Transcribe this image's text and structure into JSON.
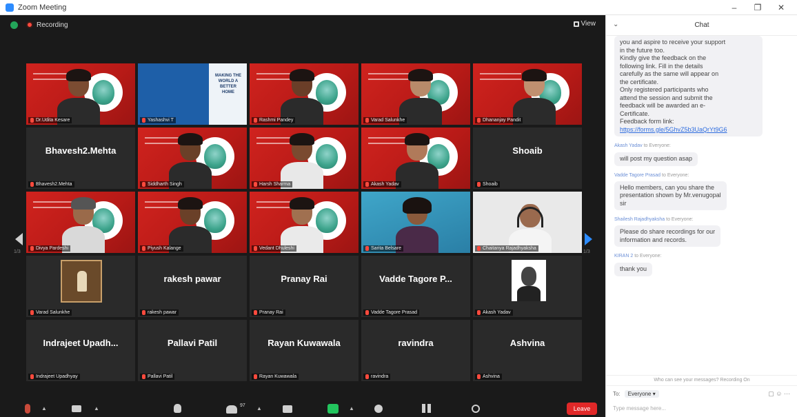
{
  "window": {
    "title": "Zoom Meeting",
    "controls": [
      "–",
      "❐",
      "✕"
    ]
  },
  "topbar": {
    "recording_label": "Recording",
    "view_label": "View"
  },
  "colors": {
    "accent": "#2D8CFF",
    "recording": "#ff4a3d",
    "leave": "#e02828",
    "share": "#23c55e",
    "active_speaker": "#d8d14a"
  },
  "grid": {
    "row1": [
      {
        "name": "Dr.Udita Kesare",
        "kind": "video"
      },
      {
        "name": "Yashashvi T",
        "kind": "blue",
        "panel_text": "MAKING THE WORLD A BETTER HOME"
      },
      {
        "name": "Rashmi Pandey",
        "kind": "video"
      },
      {
        "name": "Varad Salunkhe",
        "kind": "video"
      },
      {
        "name": "Dhananjay Pandit",
        "kind": "video",
        "active": true
      }
    ],
    "row2": [
      {
        "name": "Bhavesh2.Mehta",
        "big": "Bhavesh2.Mehta",
        "kind": "name"
      },
      {
        "name": "Siddharth Singh",
        "kind": "video"
      },
      {
        "name": "Harsh Sharma",
        "kind": "video"
      },
      {
        "name": "Akash Yadav",
        "kind": "video"
      },
      {
        "name": "Shoaib",
        "big": "Shoaib",
        "kind": "name"
      }
    ],
    "row3": [
      {
        "name": "Divya Pardeshi",
        "kind": "video"
      },
      {
        "name": "Piyush Kalange",
        "kind": "video"
      },
      {
        "name": "Vedant Dhuleshi",
        "kind": "video"
      },
      {
        "name": "Sarita Belsare",
        "kind": "teal"
      },
      {
        "name": "Chaitanya Rajadhyaksha",
        "kind": "whitebg"
      }
    ],
    "row4": [
      {
        "name": "Varad Salunkhe",
        "kind": "photo"
      },
      {
        "name": "rakesh pawar",
        "big": "rakesh pawar",
        "kind": "name"
      },
      {
        "name": "Pranay Rai",
        "big": "Pranay Rai",
        "kind": "name"
      },
      {
        "name": "Vadde Tagore Prasad",
        "big": "Vadde Tagore P...",
        "kind": "name"
      },
      {
        "name": "Akash Yadav",
        "kind": "photo-bw"
      }
    ],
    "row5": [
      {
        "name": "Indrajeet Upadhyay",
        "big": "Indrajeet Upadh...",
        "kind": "name"
      },
      {
        "name": "Pallavi Patil",
        "big": "Pallavi Patil",
        "kind": "name"
      },
      {
        "name": "Rayan Kuwawala",
        "big": "Rayan Kuwawala",
        "kind": "name"
      },
      {
        "name": "ravindra",
        "big": "ravindra",
        "kind": "name"
      },
      {
        "name": "Ashvina",
        "big": "Ashvina",
        "kind": "name"
      }
    ],
    "page_left": "1/3",
    "page_right": "1/3"
  },
  "toolbar": {
    "participants_count": "97",
    "leave_label": "Leave"
  },
  "chat": {
    "title": "Chat",
    "first_message": [
      "you and aspire to receive your support",
      "in the future too.",
      "Kindly give the feedback on the",
      "following link. Fill in the details",
      "carefully as the same will appear on",
      "the certificate.",
      "Only registered participants who",
      "attend the session and submit the",
      "feedback will be awarded an e-",
      "Certificate.",
      "Feedback form link:"
    ],
    "first_link": "https://forms.gle/5GhvZ5b3UaQrYt9G6",
    "messages": [
      {
        "from": "Akash Yadav",
        "to": "to Everyone:",
        "text": [
          "will post my question asap"
        ]
      },
      {
        "from": "Vadde Tagore Prasad",
        "to": "to Everyone:",
        "text": [
          "Hello members, can you share the",
          "presentation shown by Mr.venugopal",
          "sir"
        ]
      },
      {
        "from": "Shailesh Rajadhyaksha",
        "to": "to Everyone:",
        "text": [
          "Please do share recordings for our",
          "information and records."
        ]
      },
      {
        "from": "KIRAN 2",
        "to": "to Everyone:",
        "text": [
          "thank you"
        ]
      }
    ],
    "notice": "Who can see your messages? Recording On",
    "to_label": "To:",
    "to_value": "Everyone ▾",
    "input_placeholder": "Type message here..."
  }
}
